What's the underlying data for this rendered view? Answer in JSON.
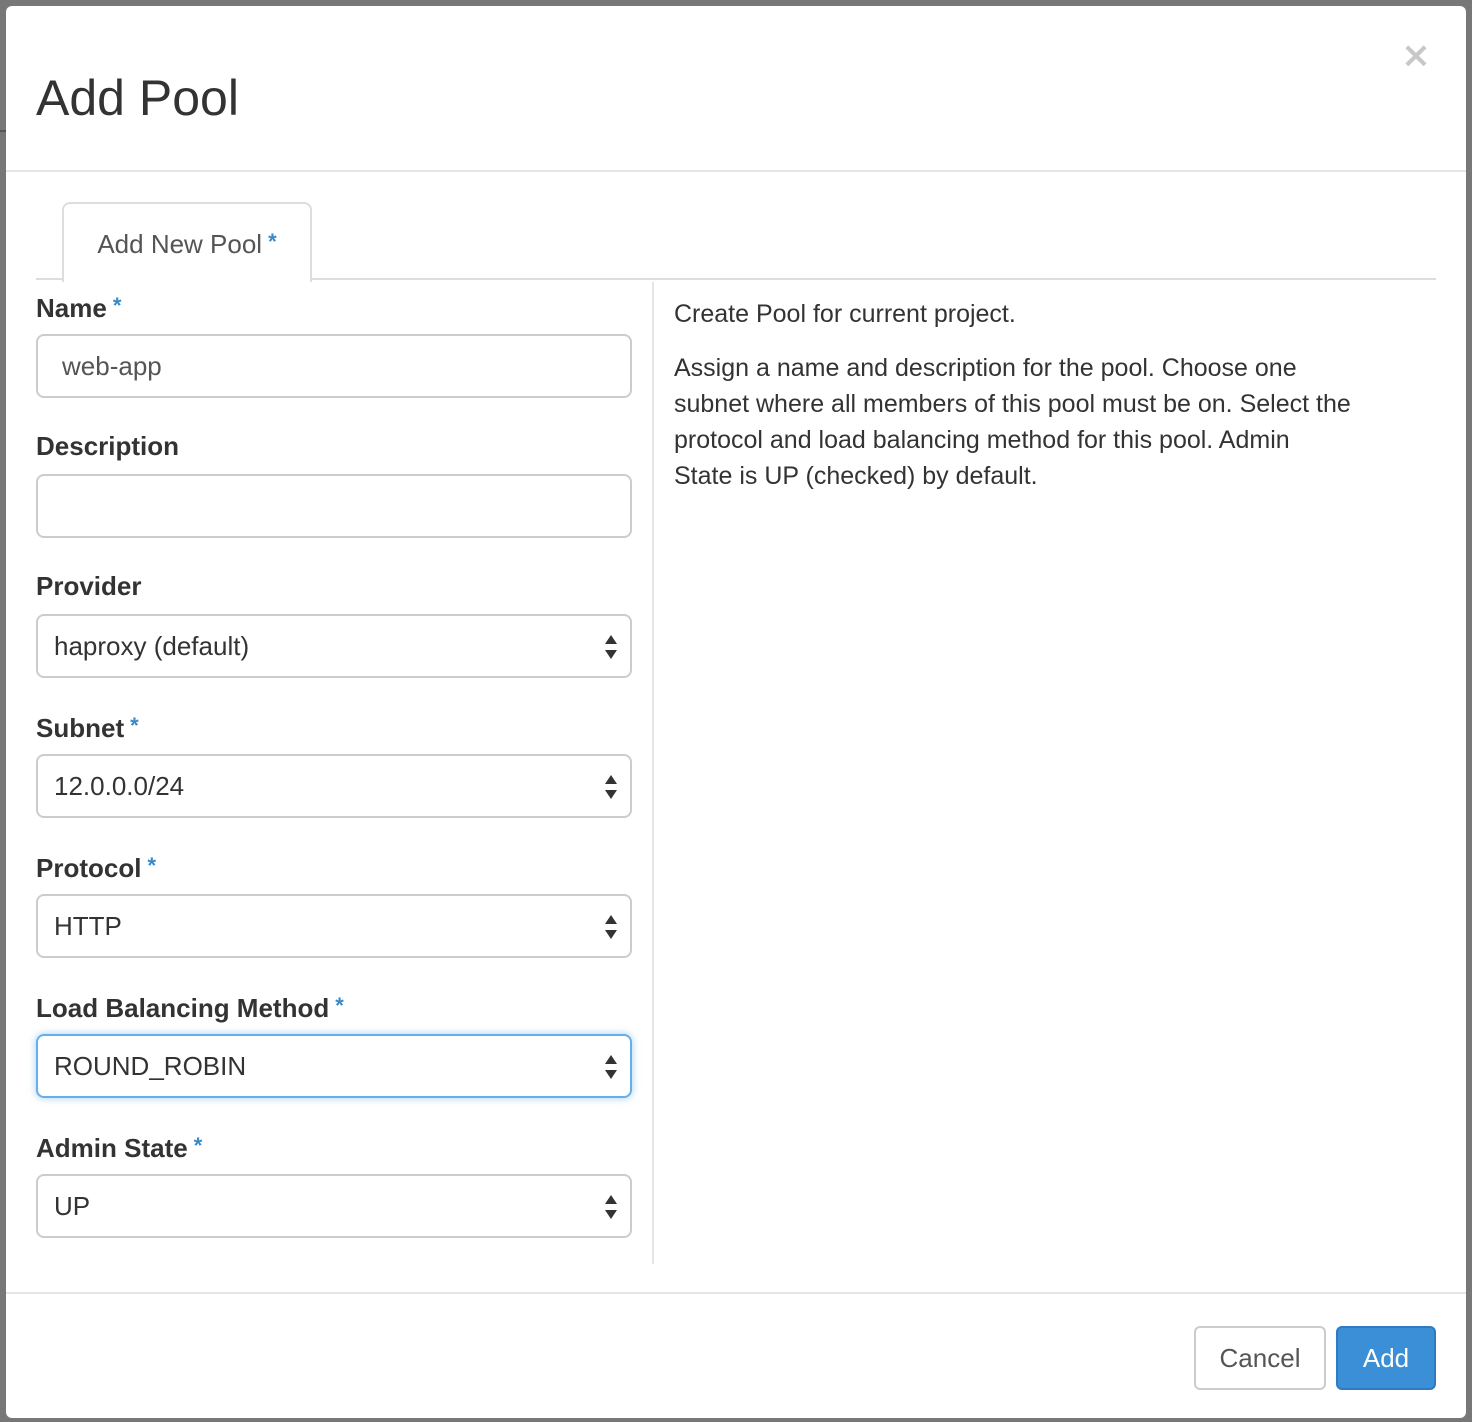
{
  "modal": {
    "title": "Add Pool",
    "close_glyph": "×"
  },
  "tabs": [
    {
      "label": "Add New Pool",
      "required_mark": "*"
    }
  ],
  "form": {
    "name": {
      "label": "Name",
      "required_mark": "*",
      "value": "web-app"
    },
    "description": {
      "label": "Description",
      "value": ""
    },
    "provider": {
      "label": "Provider",
      "value": "haproxy (default)"
    },
    "subnet": {
      "label": "Subnet",
      "required_mark": "*",
      "value": "12.0.0.0/24"
    },
    "protocol": {
      "label": "Protocol",
      "required_mark": "*",
      "value": "HTTP"
    },
    "lb_method": {
      "label": "Load Balancing Method",
      "required_mark": "*",
      "value": "ROUND_ROBIN"
    },
    "admin_state": {
      "label": "Admin State",
      "required_mark": "*",
      "value": "UP"
    }
  },
  "help": {
    "line1": "Create Pool for current project.",
    "line2": "Assign a name and description for the pool. Choose one subnet where all members of this pool must be on. Select the protocol and load balancing method for this pool. Admin State is UP (checked) by default."
  },
  "footer": {
    "cancel_label": "Cancel",
    "add_label": "Add"
  },
  "colors": {
    "accent": "#3a8fd6",
    "required": "#3989c7",
    "focus": "#66afe9"
  },
  "icons": {
    "close": "close-icon",
    "select_arrows": "select-arrows-icon"
  }
}
